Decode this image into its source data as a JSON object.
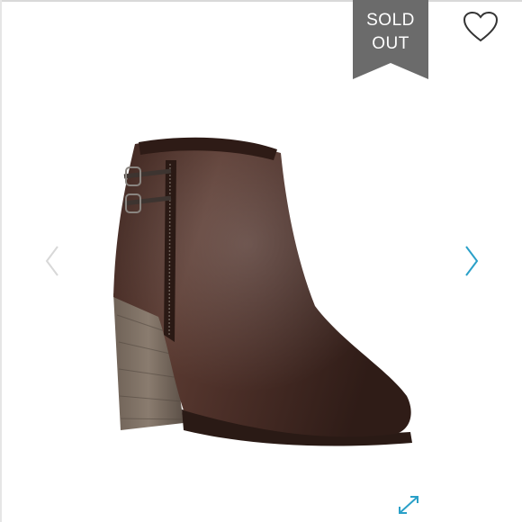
{
  "badge": {
    "line1": "SOLD",
    "line2": "OUT",
    "color": "#6b6b6b"
  },
  "icons": {
    "heart": "heart-icon",
    "prev": "chevron-left-icon",
    "next": "chevron-right-icon",
    "expand": "expand-icon"
  },
  "colors": {
    "accent": "#2aa0c8",
    "prev_arrow": "#d8d8d8",
    "heart_outline": "#333333"
  }
}
